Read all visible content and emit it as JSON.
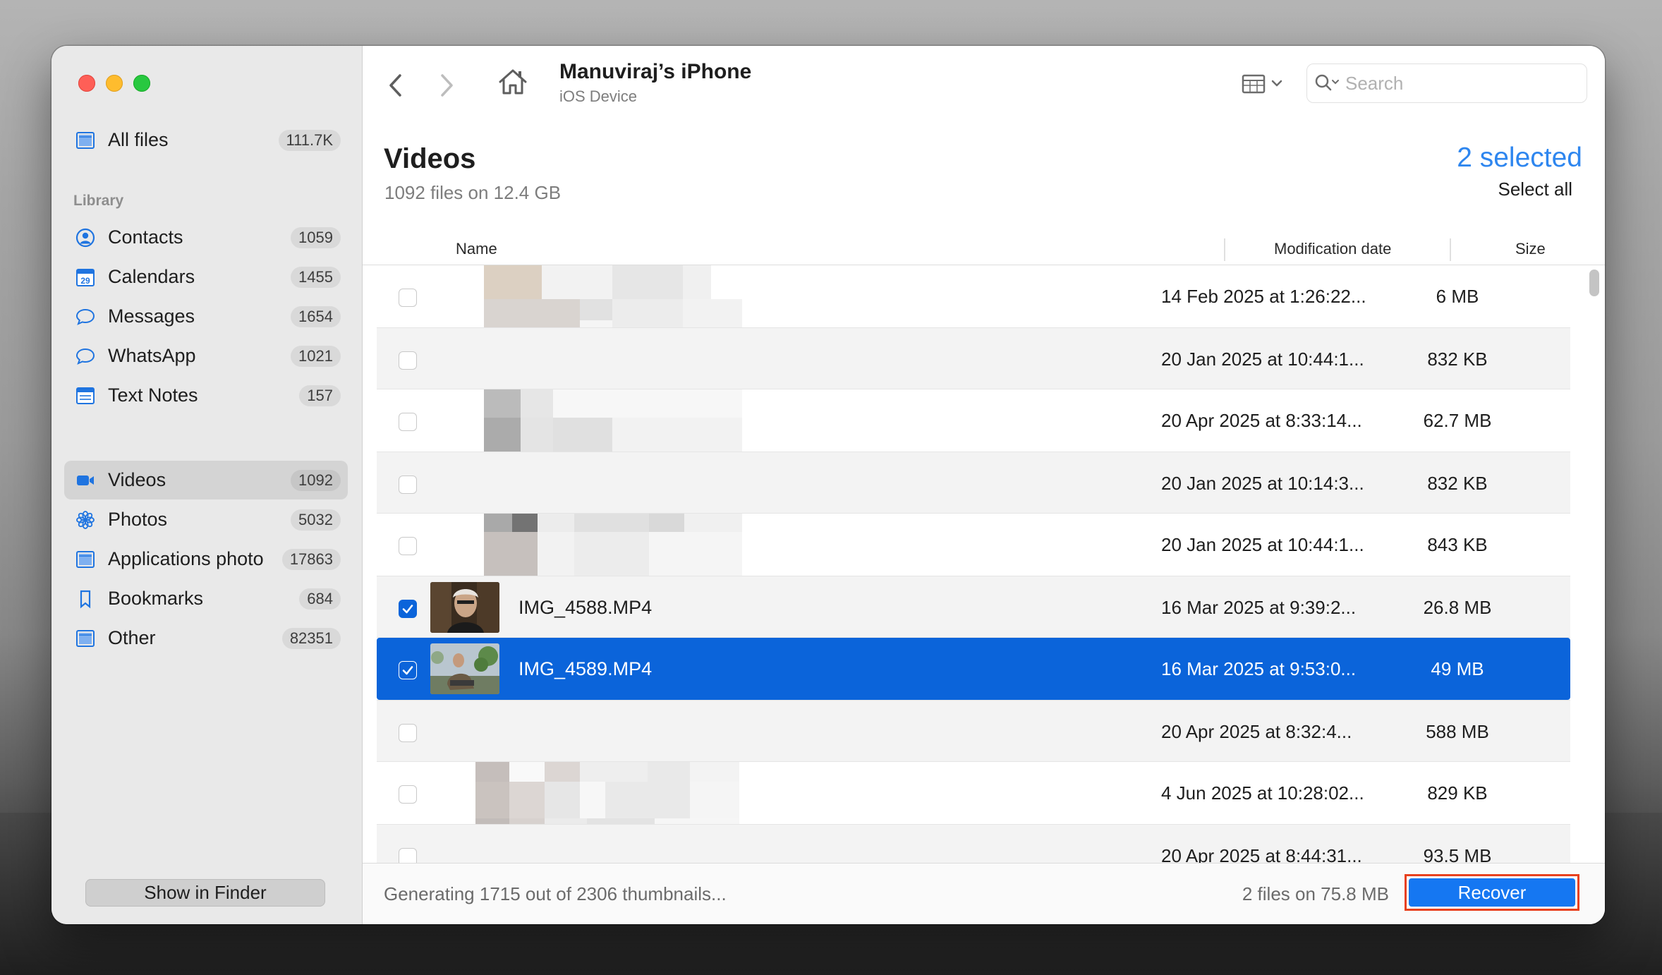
{
  "window": {
    "device_title": "Manuviraj’s iPhone",
    "device_subtitle": "iOS Device",
    "search_placeholder": "Search"
  },
  "sidebar": {
    "all_files": {
      "label": "All files",
      "count": "111.7K",
      "icon": "all-files-icon"
    },
    "section_label": "Library",
    "items": [
      {
        "label": "Contacts",
        "count": "1059",
        "icon": "contact-icon"
      },
      {
        "label": "Calendars",
        "count": "1455",
        "icon": "calendar-icon",
        "icon_text": "29"
      },
      {
        "label": "Messages",
        "count": "1654",
        "icon": "message-bubble-icon"
      },
      {
        "label": "WhatsApp",
        "count": "1021",
        "icon": "message-bubble-icon"
      },
      {
        "label": "Text Notes",
        "count": "157",
        "icon": "notes-icon"
      },
      {
        "label": "Videos",
        "count": "1092",
        "icon": "video-camera-icon",
        "active": true
      },
      {
        "label": "Photos",
        "count": "5032",
        "icon": "photos-flower-icon"
      },
      {
        "label": "Applications photo",
        "count": "17863",
        "icon": "app-photo-icon"
      },
      {
        "label": "Bookmarks",
        "count": "684",
        "icon": "bookmark-icon"
      },
      {
        "label": "Other",
        "count": "82351",
        "icon": "folder-icon"
      }
    ],
    "show_in_finder": "Show in Finder"
  },
  "content": {
    "title": "Videos",
    "subtitle": "1092 files on 12.4 GB",
    "selected_text": "2 selected",
    "select_all": "Select all",
    "columns": {
      "name": "Name",
      "date": "Modification date",
      "size": "Size"
    },
    "rows": [
      {
        "name": "",
        "date": "14 Feb 2025 at 1:26:22...",
        "size": "6 MB",
        "checked": false
      },
      {
        "name": "",
        "date": "20 Jan 2025 at 10:44:1...",
        "size": "832 KB",
        "checked": false
      },
      {
        "name": "",
        "date": "20 Apr 2025 at 8:33:14...",
        "size": "62.7 MB",
        "checked": false
      },
      {
        "name": "",
        "date": "20 Jan 2025 at 10:14:3...",
        "size": "832 KB",
        "checked": false
      },
      {
        "name": "",
        "date": "20 Jan 2025 at 10:44:1...",
        "size": "843 KB",
        "checked": false
      },
      {
        "name": "IMG_4588.MP4",
        "date": "16 Mar 2025 at 9:39:2...",
        "size": "26.8 MB",
        "checked": true
      },
      {
        "name": "IMG_4589.MP4",
        "date": "16 Mar 2025 at 9:53:0...",
        "size": "49 MB",
        "checked": true,
        "highlighted": true
      },
      {
        "name": "",
        "date": "20 Apr 2025 at 8:32:4...",
        "size": "588 MB",
        "checked": false
      },
      {
        "name": "",
        "date": "4 Jun 2025 at 10:28:02...",
        "size": "829 KB",
        "checked": false
      },
      {
        "name": "",
        "date": "20 Apr 2025 at 8:44:31...",
        "size": "93.5 MB",
        "checked": false
      }
    ]
  },
  "footer": {
    "status": "Generating 1715 out of 2306 thumbnails...",
    "summary": "2 files on 75.8 MB",
    "recover": "Recover"
  },
  "colors": {
    "accent": "#0b64da",
    "selected_text": "#2e86ef",
    "recover_button": "#1577f2",
    "recover_outline": "#e8401e"
  }
}
